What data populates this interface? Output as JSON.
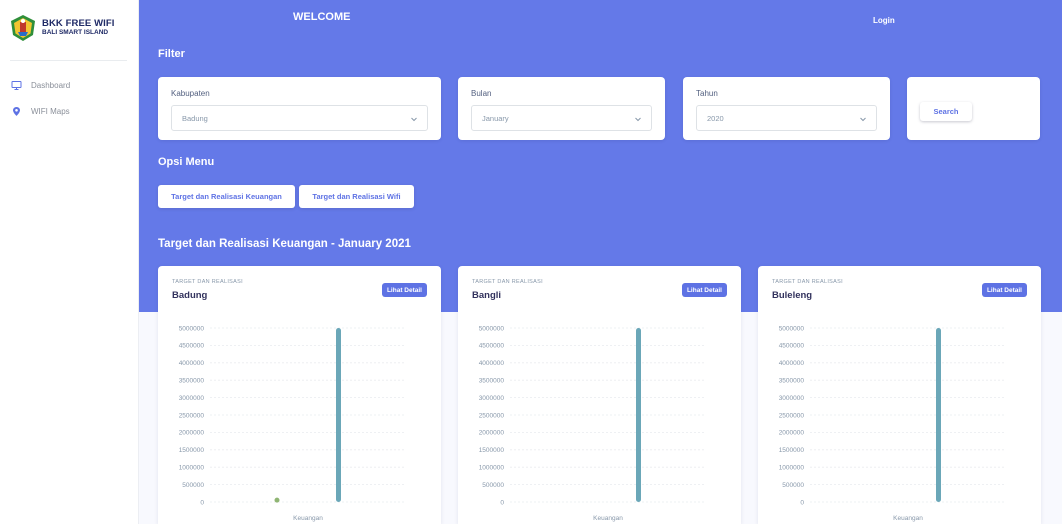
{
  "sidebar": {
    "brand_title": "BKK FREE WIFI",
    "brand_subtitle": "BALI SMART ISLAND",
    "items": [
      {
        "label": "Dashboard",
        "icon": "monitor-icon"
      },
      {
        "label": "WIFI Maps",
        "icon": "map-pin-icon"
      }
    ]
  },
  "header": {
    "welcome": "WELCOME",
    "login": "Login"
  },
  "filter": {
    "title": "Filter",
    "kabupaten": {
      "label": "Kabupaten",
      "value": "Badung"
    },
    "bulan": {
      "label": "Bulan",
      "value": "January"
    },
    "tahun": {
      "label": "Tahun",
      "value": "2020"
    },
    "search_label": "Search"
  },
  "opsi": {
    "title": "Opsi Menu",
    "buttons": [
      "Target dan Realisasi Keuangan",
      "Target dan Realisasi Wifi"
    ]
  },
  "charts_section": {
    "title": "Target dan Realisasi Keuangan - January 2021"
  },
  "colors": {
    "header": "#6479e8",
    "accent": "#5e72e4",
    "target_series": "#6ba7b8",
    "realisasi_series": "#8fb573"
  },
  "chart_data": [
    {
      "type": "bar",
      "eyebrow": "TARGET DAN REALISASI",
      "title": "Badung",
      "detail_label": "Lihat Detail",
      "categories": [
        "Keuangan"
      ],
      "series": [
        {
          "values": [
            10000
          ]
        },
        {
          "values": [
            5000000
          ]
        }
      ],
      "yticks": [
        "5000000",
        "4500000",
        "4000000",
        "3500000",
        "3000000",
        "2500000",
        "2000000",
        "1500000",
        "1000000",
        "500000",
        "0"
      ],
      "ylim": [
        0,
        5000000
      ],
      "grid": true
    },
    {
      "type": "bar",
      "eyebrow": "TARGET DAN REALISASI",
      "title": "Bangli",
      "detail_label": "Lihat Detail",
      "categories": [
        "Keuangan"
      ],
      "series": [
        {
          "values": [
            0
          ]
        },
        {
          "values": [
            5000000
          ]
        }
      ],
      "yticks": [
        "5000000",
        "4500000",
        "4000000",
        "3500000",
        "3000000",
        "2500000",
        "2000000",
        "1500000",
        "1000000",
        "500000",
        "0"
      ],
      "ylim": [
        0,
        5000000
      ],
      "grid": true
    },
    {
      "type": "bar",
      "eyebrow": "TARGET DAN REALISASI",
      "title": "Buleleng",
      "detail_label": "Lihat Detail",
      "categories": [
        "Keuangan"
      ],
      "series": [
        {
          "values": [
            0
          ]
        },
        {
          "values": [
            5000000
          ]
        }
      ],
      "yticks": [
        "5000000",
        "4500000",
        "4000000",
        "3500000",
        "3000000",
        "2500000",
        "2000000",
        "1500000",
        "1000000",
        "500000",
        "0"
      ],
      "ylim": [
        0,
        5000000
      ],
      "grid": true
    }
  ]
}
